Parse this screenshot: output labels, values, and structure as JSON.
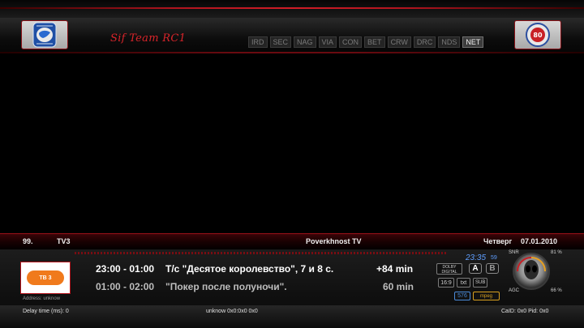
{
  "header": {
    "team_name": "Sif Team RC1",
    "left_logo": "emblem-logo",
    "right_logo": "team-badge-logo",
    "right_logo_number": "80",
    "modules": [
      {
        "label": "IRD",
        "active": false
      },
      {
        "label": "SEC",
        "active": false
      },
      {
        "label": "NAG",
        "active": false
      },
      {
        "label": "VIA",
        "active": false
      },
      {
        "label": "CON",
        "active": false
      },
      {
        "label": "BET",
        "active": false
      },
      {
        "label": "CRW",
        "active": false
      },
      {
        "label": "DRC",
        "active": false
      },
      {
        "label": "NDS",
        "active": false
      },
      {
        "label": "NET",
        "active": true
      }
    ]
  },
  "channel": {
    "number": "99.",
    "name": "TV3",
    "provider": "Poverkhnost TV",
    "day": "Четверг",
    "date": "07.01.2010"
  },
  "info": {
    "provider_logo": "ТВ 3",
    "address": "Address: unknow",
    "events": [
      {
        "time": "23:00 - 01:00",
        "title": "Т/с \"Десятое королевство\", 7 и 8 с.",
        "remaining": "+84 min"
      },
      {
        "time": "01:00 - 02:00",
        "title": "\"Покер после полуночи\".",
        "remaining": "60 min"
      }
    ],
    "clock": "23:35",
    "clock_seconds": "59",
    "badges": {
      "dolby": "DOLBY",
      "digital": "DIGITAL",
      "audio_a": "A",
      "audio_b": "B",
      "aspect": "16:9",
      "txt": "txt",
      "sub": "SUB",
      "resolution": "576",
      "mode": "mpeg"
    },
    "snr_label": "SNR",
    "snr_value": "81 %",
    "agc_label": "AGC",
    "agc_value": "66 %"
  },
  "status": {
    "delay": "Delay time (ms): 0",
    "ecm": "unknow 0x0:0x0 0x0",
    "caid": "CaID: 0x0 Pid: 0x0"
  },
  "colors": {
    "accent_red": "#d01c26",
    "clock_blue": "#5f9fff",
    "mpeg_badge": "#d8a020",
    "res_badge": "#4a8ad8"
  }
}
